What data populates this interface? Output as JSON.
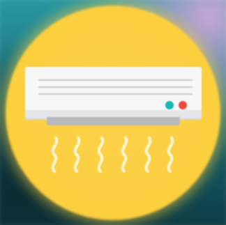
{
  "image": {
    "subject": "air-conditioner-icon",
    "colors": {
      "disc": "#fccf3e",
      "unit_body": "#f7f7f7",
      "vent": "#b9b9bd",
      "indicator_teal": "#13b8b0",
      "indicator_red": "#e74c3c",
      "airflow_lines": "#fff6d8",
      "background_top": "#2a9aa3",
      "background_bottom": "#0d3a42"
    },
    "airflow_line_count": 6,
    "indicator_lights": [
      "teal",
      "red"
    ]
  }
}
